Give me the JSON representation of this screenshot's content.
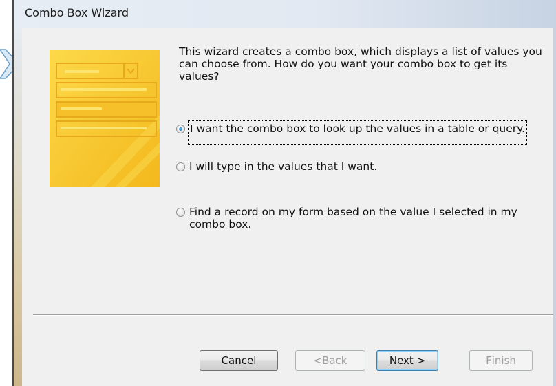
{
  "window": {
    "title": "Combo Box Wizard"
  },
  "intro": {
    "text": "This wizard creates a combo box, which displays a list of values you\ncan choose from.  How do you want your combo box to get its\nvalues?"
  },
  "options": [
    {
      "label": "I want the combo box to look up the values in a table or query.",
      "selected": true
    },
    {
      "label": "I will type in the values that I want.",
      "selected": false
    },
    {
      "label": "Find a record on my form based on the value I selected in my\ncombo box.",
      "selected": false
    }
  ],
  "buttons": {
    "cancel": "Cancel",
    "back_pre": "< ",
    "back_key": "B",
    "back_post": "ack",
    "next_key": "N",
    "next_post": "ext >",
    "finish_key": "F",
    "finish_post": "inish"
  },
  "colors": {
    "art_primary": "#f7c820",
    "art_accent": "#e5a31d",
    "accent": "#3c7fb1"
  }
}
